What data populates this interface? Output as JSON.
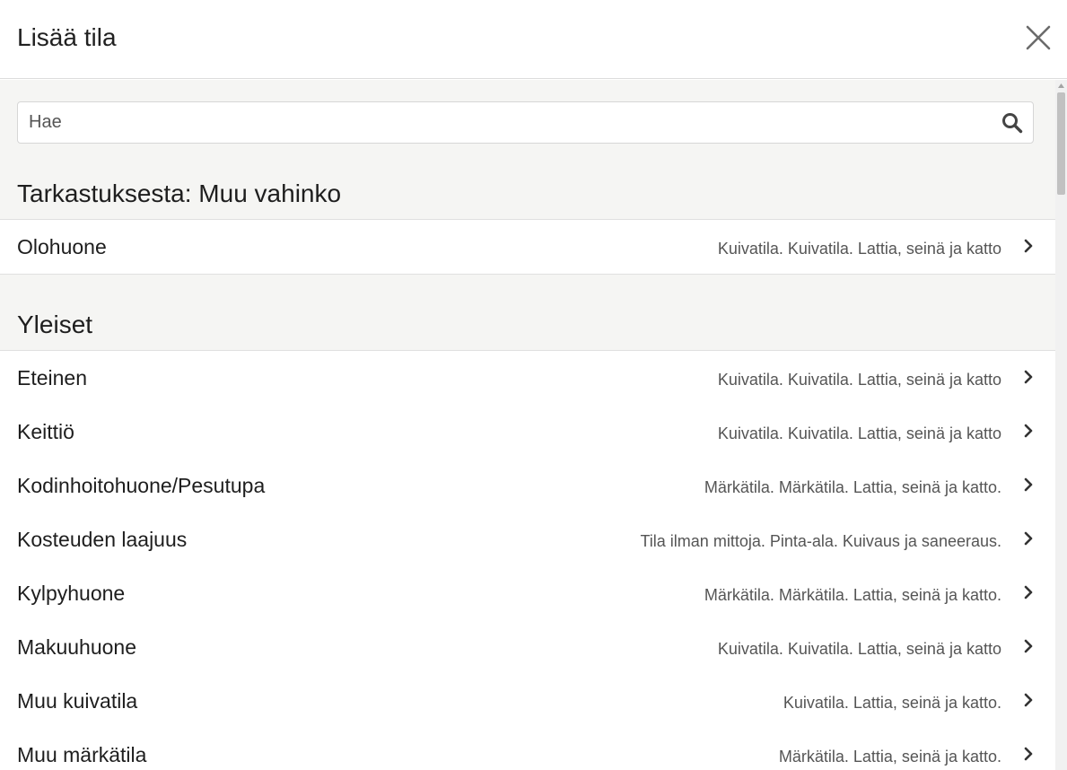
{
  "header": {
    "title": "Lisää tila"
  },
  "search": {
    "placeholder": "Hae",
    "value": ""
  },
  "sections": [
    {
      "title": "Tarkastuksesta: Muu vahinko",
      "items": [
        {
          "name": "Olohuone",
          "description": "Kuivatila. Kuivatila. Lattia, seinä ja katto"
        }
      ]
    },
    {
      "title": "Yleiset",
      "items": [
        {
          "name": "Eteinen",
          "description": "Kuivatila. Kuivatila. Lattia, seinä ja katto"
        },
        {
          "name": "Keittiö",
          "description": "Kuivatila. Kuivatila. Lattia, seinä ja katto"
        },
        {
          "name": "Kodinhoitohuone/Pesutupa",
          "description": "Märkätila. Märkätila. Lattia, seinä ja katto."
        },
        {
          "name": "Kosteuden laajuus",
          "description": "Tila ilman mittoja. Pinta-ala. Kuivaus ja saneeraus."
        },
        {
          "name": "Kylpyhuone",
          "description": "Märkätila. Märkätila. Lattia, seinä ja katto."
        },
        {
          "name": "Makuuhuone",
          "description": "Kuivatila. Kuivatila. Lattia, seinä ja katto"
        },
        {
          "name": "Muu kuivatila",
          "description": "Kuivatila. Lattia, seinä ja katto."
        },
        {
          "name": "Muu märkätila",
          "description": "Märkätila. Lattia, seinä ja katto."
        }
      ]
    }
  ],
  "icons": {
    "close": "close-icon",
    "search": "search-icon",
    "chevron": "chevron-right-icon"
  }
}
